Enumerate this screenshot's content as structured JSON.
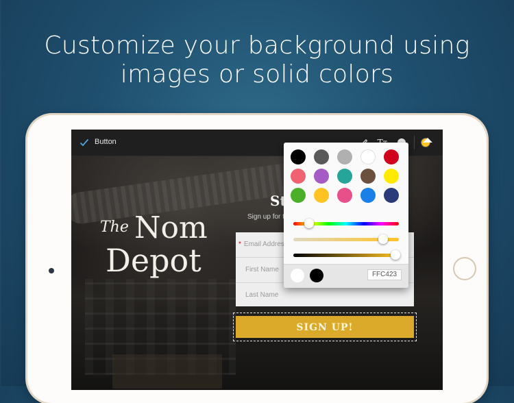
{
  "headline": {
    "line1": "Customize your background using",
    "line2": "images or solid colors"
  },
  "toolbar": {
    "label": "Button",
    "icons": [
      "check-icon",
      "pencil-icon",
      "text-size-icon",
      "background-color-icon",
      "active-color-icon"
    ],
    "text_size_glyph": "Tт",
    "active_color": "#ffc423"
  },
  "logo": {
    "the": "The",
    "nom": "Nom",
    "depot": "Depot"
  },
  "signup": {
    "title": "Stay",
    "subtext": "Sign up for the lates",
    "fields": [
      {
        "placeholder": "Email Address",
        "required": true
      },
      {
        "placeholder": "First Name",
        "required": false
      },
      {
        "placeholder": "Last Name",
        "required": false
      }
    ],
    "button_label": "SIGN UP!",
    "button_color": "#dcaa2a"
  },
  "color_picker": {
    "swatches": [
      "#000000",
      "#5a5a5a",
      "#b0b0b0",
      "#ffffff",
      "#d0021b",
      "#f06272",
      "#a55ac6",
      "#26a69a",
      "#6b4f3f",
      "#ffea00",
      "#4caf2a",
      "#ffc423",
      "#e8508a",
      "#1a7fe8",
      "#2b3a78"
    ],
    "hue": 0.15,
    "saturation": 0.85,
    "brightness": 0.97,
    "recent_colors": [
      "#ffffff",
      "#000000"
    ],
    "hex_value": "FFC423"
  }
}
